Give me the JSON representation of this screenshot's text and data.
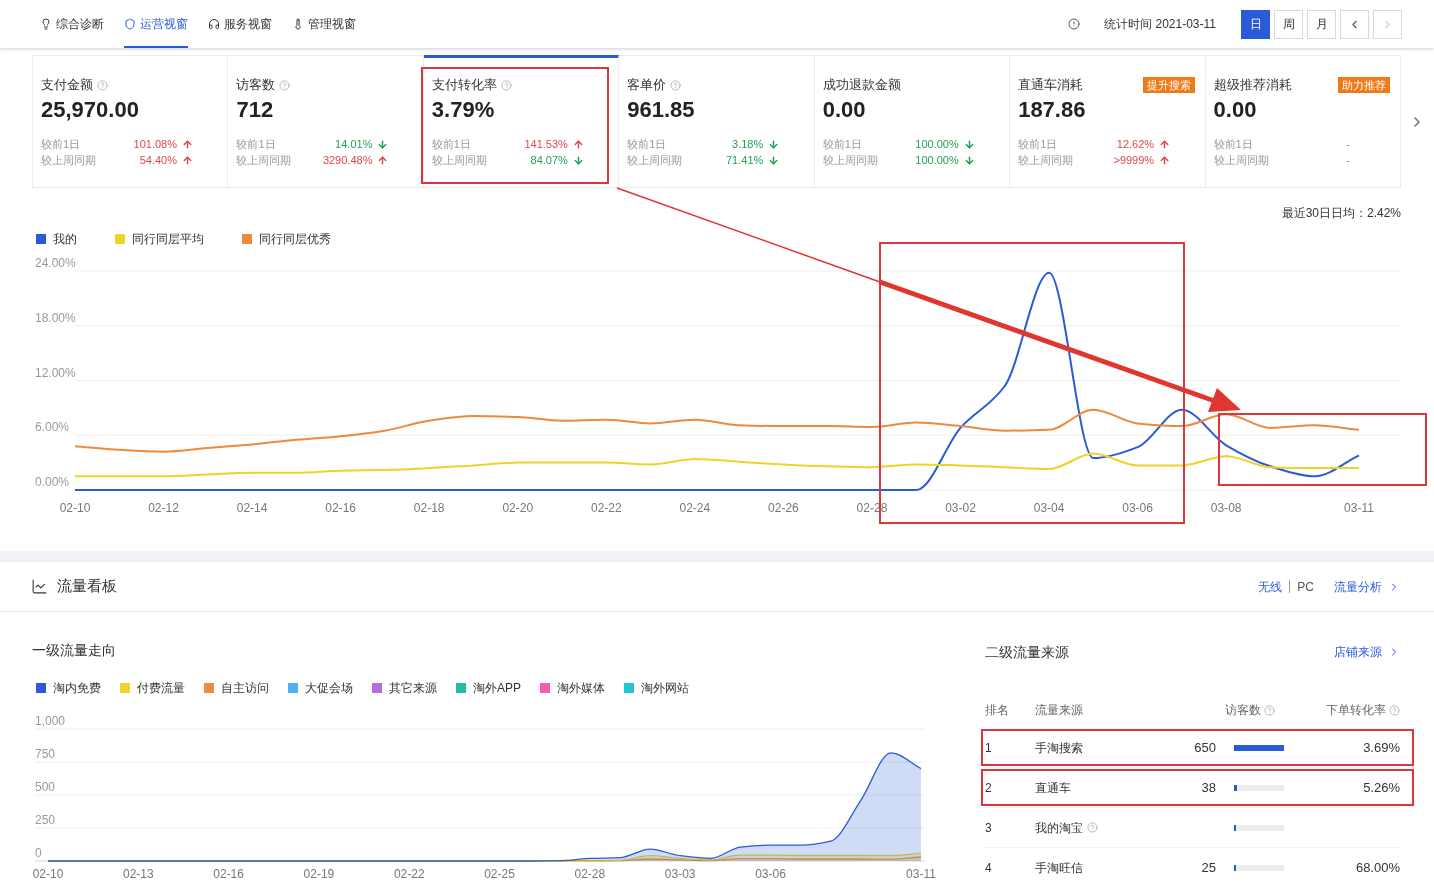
{
  "tabs": [
    {
      "label": "综合诊断",
      "selected": false
    },
    {
      "label": "运营视窗",
      "selected": true
    },
    {
      "label": "服务视窗",
      "selected": false
    },
    {
      "label": "管理视窗",
      "selected": false
    }
  ],
  "stat_time": "统计时间 2021-03-11",
  "periods": [
    {
      "label": "日",
      "selected": true
    },
    {
      "label": "周",
      "selected": false
    },
    {
      "label": "月",
      "selected": false
    }
  ],
  "pager": {
    "prev_disabled": false,
    "next_disabled": true
  },
  "metric_cards": [
    {
      "title": "支付金额",
      "help": true,
      "value": "25,970.00",
      "selected": false,
      "highlighted": false,
      "comparisons": [
        {
          "label": "较前1日",
          "value": "101.08%",
          "kind": "up"
        },
        {
          "label": "较上周同期",
          "value": "54.40%",
          "kind": "up"
        }
      ]
    },
    {
      "title": "访客数",
      "help": true,
      "value": "712",
      "selected": false,
      "highlighted": false,
      "comparisons": [
        {
          "label": "较前1日",
          "value": "14.01%",
          "kind": "down"
        },
        {
          "label": "较上周同期",
          "value": "3290.48%",
          "kind": "up"
        }
      ]
    },
    {
      "title": "支付转化率",
      "help": true,
      "value": "3.79%",
      "selected": true,
      "highlighted": true,
      "comparisons": [
        {
          "label": "较前1日",
          "value": "141.53%",
          "kind": "up"
        },
        {
          "label": "较上周同期",
          "value": "84.07%",
          "kind": "down"
        }
      ]
    },
    {
      "title": "客单价",
      "help": true,
      "value": "961.85",
      "selected": false,
      "highlighted": false,
      "comparisons": [
        {
          "label": "较前1日",
          "value": "3.18%",
          "kind": "down"
        },
        {
          "label": "较上周同期",
          "value": "71.41%",
          "kind": "down"
        }
      ]
    },
    {
      "title": "成功退款金额",
      "help": false,
      "value": "0.00",
      "selected": false,
      "highlighted": false,
      "comparisons": [
        {
          "label": "较前1日",
          "value": "100.00%",
          "kind": "down"
        },
        {
          "label": "较上周同期",
          "value": "100.00%",
          "kind": "down"
        }
      ]
    },
    {
      "title": "直通车消耗",
      "help": false,
      "badge": "提升搜索",
      "value": "187.86",
      "selected": false,
      "highlighted": false,
      "comparisons": [
        {
          "label": "较前1日",
          "value": "12.62%",
          "kind": "up"
        },
        {
          "label": "较上周同期",
          "value": ">9999%",
          "kind": "up"
        }
      ]
    },
    {
      "title": "超级推荐消耗",
      "help": false,
      "badge": "助力推荐",
      "value": "0.00",
      "selected": false,
      "highlighted": false,
      "comparisons": [
        {
          "label": "较前1日",
          "value": "-",
          "kind": "none"
        },
        {
          "label": "较上周同期",
          "value": "-",
          "kind": "none"
        }
      ]
    }
  ],
  "trend": {
    "summary": "最近30日日均：2.42%",
    "chart_data": {
      "type": "line",
      "grid": true,
      "categories": [
        "02-10",
        null,
        "02-12",
        null,
        "02-14",
        null,
        "02-16",
        null,
        "02-18",
        null,
        "02-20",
        null,
        "02-22",
        null,
        "02-24",
        null,
        "02-26",
        null,
        "02-28",
        null,
        "03-02",
        null,
        "03-04",
        null,
        "03-06",
        null,
        "03-08",
        null,
        null,
        "03-11"
      ],
      "ylim": [
        0,
        24
      ],
      "yticks": [
        {
          "value": 0,
          "label": "0.00%"
        },
        {
          "value": 6,
          "label": "6.00%"
        },
        {
          "value": 12,
          "label": "12.00%"
        },
        {
          "value": 18,
          "label": "18.00%"
        },
        {
          "value": 24,
          "label": "24.00%"
        }
      ],
      "series": [
        {
          "name": "我的",
          "color": "#2a5bd7",
          "values": [
            0,
            0,
            0,
            0,
            0,
            0,
            0,
            0,
            0,
            0,
            0,
            0,
            0,
            0,
            0,
            0,
            0,
            0,
            0,
            0,
            6.8,
            11.4,
            23.8,
            3.5,
            4.7,
            8.8,
            4.9,
            2.6,
            1.5,
            3.8
          ]
        },
        {
          "name": "同行同层平均",
          "color": "#f0d327",
          "values": [
            1.5,
            1.5,
            1.5,
            1.7,
            1.9,
            1.9,
            2.1,
            2.2,
            2.4,
            2.7,
            3.0,
            3.0,
            3.0,
            2.8,
            3.4,
            3.1,
            2.8,
            2.6,
            2.5,
            2.8,
            2.7,
            2.5,
            2.3,
            4.0,
            2.7,
            2.7,
            3.7,
            2.5,
            2.4,
            2.4
          ]
        },
        {
          "name": "同行同层优秀",
          "color": "#ef8a3c",
          "values": [
            4.8,
            4.4,
            4.2,
            4.6,
            5.0,
            5.5,
            5.9,
            6.5,
            7.6,
            8.1,
            8.0,
            7.6,
            7.7,
            7.3,
            7.7,
            7.1,
            7.0,
            7.0,
            6.9,
            7.4,
            7.0,
            6.5,
            6.6,
            8.8,
            7.3,
            7.0,
            8.3,
            6.8,
            7.1,
            6.6
          ]
        }
      ]
    }
  },
  "annotations": [
    {
      "kind": "arrow"
    },
    {
      "kind": "frame"
    },
    {
      "kind": "frame"
    }
  ],
  "traffic_board": {
    "title": "流量看板",
    "devices": [
      {
        "label": "无线",
        "selected": true
      },
      {
        "label": "PC",
        "selected": false
      }
    ],
    "analysis_link": "流量分析",
    "primary": {
      "title": "一级流量走向",
      "chart_data": {
        "type": "area",
        "stacked": false,
        "grid": true,
        "categories": [
          "02-10",
          null,
          null,
          "02-13",
          null,
          null,
          "02-16",
          null,
          null,
          "02-19",
          null,
          null,
          "02-22",
          null,
          null,
          "02-25",
          null,
          null,
          "02-28",
          null,
          null,
          "03-03",
          null,
          null,
          "03-06",
          null,
          null,
          null,
          null,
          "03-11"
        ],
        "ylim": [
          0,
          1000
        ],
        "yticks": [
          {
            "value": 0,
            "label": "0"
          },
          {
            "value": 250,
            "label": "250"
          },
          {
            "value": 500,
            "label": "500"
          },
          {
            "value": 750,
            "label": "750"
          },
          {
            "value": 1000,
            "label": "1,000"
          }
        ],
        "series": [
          {
            "name": "淘内免费",
            "color": "#2a5bd7",
            "values": [
              0,
              0,
              0,
              0,
              0,
              0,
              0,
              0,
              0,
              0,
              0,
              0,
              0,
              0,
              0,
              0,
              0,
              2,
              20,
              25,
              90,
              40,
              20,
              105,
              120,
              120,
              150,
              460,
              820,
              700
            ]
          },
          {
            "name": "付费流量",
            "color": "#f0d327",
            "values": [
              0,
              0,
              0,
              0,
              0,
              0,
              0,
              0,
              0,
              0,
              0,
              0,
              0,
              0,
              0,
              0,
              0,
              0,
              0,
              5,
              40,
              20,
              8,
              45,
              45,
              42,
              42,
              42,
              40,
              60
            ]
          },
          {
            "name": "自主访问",
            "color": "#ef8a3c",
            "values": [
              0,
              0,
              0,
              0,
              0,
              0,
              0,
              0,
              0,
              0,
              0,
              0,
              0,
              0,
              0,
              0,
              0,
              0,
              0,
              2,
              15,
              8,
              3,
              18,
              18,
              15,
              15,
              15,
              14,
              30
            ]
          },
          {
            "name": "大促会场",
            "color": "#4eb0ef",
            "values": [
              null,
              null,
              null,
              null,
              null,
              null,
              null,
              null,
              null,
              null,
              null,
              null,
              null,
              null,
              null,
              null,
              null,
              null,
              null,
              null,
              null,
              null,
              null,
              null,
              null,
              null,
              null,
              null,
              null,
              null
            ]
          },
          {
            "name": "其它来源",
            "color": "#b46ee0",
            "values": [
              null,
              null,
              null,
              null,
              null,
              null,
              null,
              null,
              null,
              null,
              null,
              null,
              null,
              null,
              null,
              null,
              null,
              null,
              null,
              null,
              null,
              null,
              null,
              null,
              null,
              null,
              null,
              null,
              null,
              null
            ]
          },
          {
            "name": "淘外APP",
            "color": "#1fbf9c",
            "values": [
              null,
              null,
              null,
              null,
              null,
              null,
              null,
              null,
              null,
              null,
              null,
              null,
              null,
              null,
              null,
              null,
              null,
              null,
              null,
              null,
              null,
              null,
              null,
              null,
              null,
              null,
              null,
              null,
              null,
              null
            ]
          },
          {
            "name": "淘外媒体",
            "color": "#ef5fae",
            "values": [
              null,
              null,
              null,
              null,
              null,
              null,
              null,
              null,
              null,
              null,
              null,
              null,
              null,
              null,
              null,
              null,
              null,
              null,
              null,
              null,
              null,
              null,
              null,
              null,
              null,
              null,
              null,
              null,
              null,
              null
            ]
          },
          {
            "name": "淘外网站",
            "color": "#1fc8c8",
            "values": [
              null,
              null,
              null,
              null,
              null,
              null,
              null,
              null,
              null,
              null,
              null,
              null,
              null,
              null,
              null,
              null,
              null,
              null,
              null,
              null,
              null,
              null,
              null,
              null,
              null,
              null,
              null,
              null,
              null,
              null
            ]
          }
        ]
      }
    },
    "secondary": {
      "title": "二级流量来源",
      "link": "店铺来源",
      "columns": [
        {
          "label": "排名"
        },
        {
          "label": "流量来源"
        },
        {
          "label": "访客数",
          "help": true
        },
        {
          "label": "下单转化率",
          "help": true
        }
      ],
      "rows": [
        {
          "rank": "1",
          "source": "手淘搜索",
          "help": false,
          "visitors": "650",
          "level": 1,
          "rate": "3.69%",
          "highlighted": true
        },
        {
          "rank": "2",
          "source": "直通车",
          "help": false,
          "visitors": "38",
          "level": 0.06,
          "rate": "5.26%",
          "highlighted": true
        },
        {
          "rank": "3",
          "source": "我的淘宝",
          "help": true,
          "level": 0.04,
          "highlighted": false
        },
        {
          "rank": "4",
          "source": "手淘旺信",
          "help": false,
          "visitors": "25",
          "level": 0.04,
          "rate": "68.00%",
          "highlighted": false
        }
      ]
    }
  }
}
